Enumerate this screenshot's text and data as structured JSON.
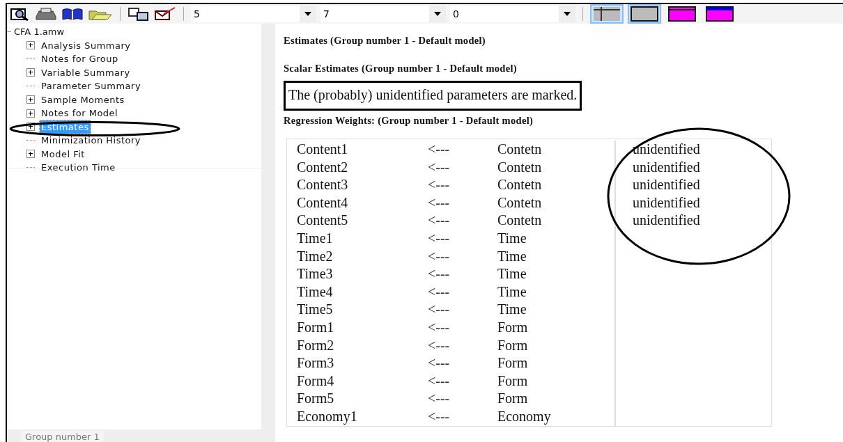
{
  "toolbar": {
    "icons": [
      {
        "kind": "preview"
      },
      {
        "kind": "print"
      },
      {
        "kind": "book"
      },
      {
        "kind": "folder"
      },
      {
        "kind": "copy"
      },
      {
        "kind": "check"
      }
    ],
    "combos": [
      {
        "value": "5"
      },
      {
        "value": "7"
      },
      {
        "value": "0"
      }
    ],
    "styles": [
      {
        "kind": "grid",
        "selected": true
      },
      {
        "kind": "plain",
        "selected": true
      },
      {
        "kind": "magenta",
        "selected": false
      },
      {
        "kind": "blue-magenta",
        "selected": false
      }
    ]
  },
  "tree": {
    "root": "CFA 1.amw",
    "items": [
      {
        "label": "Analysis Summary",
        "expandable": true,
        "selected": false
      },
      {
        "label": "Notes for Group",
        "expandable": false,
        "selected": false
      },
      {
        "label": "Variable Summary",
        "expandable": true,
        "selected": false
      },
      {
        "label": "Parameter Summary",
        "expandable": false,
        "selected": false
      },
      {
        "label": "Sample Moments",
        "expandable": true,
        "selected": false
      },
      {
        "label": "Notes for Model",
        "expandable": true,
        "selected": false
      },
      {
        "label": "Estimates",
        "expandable": true,
        "selected": true
      },
      {
        "label": "Minimization History",
        "expandable": false,
        "selected": false
      },
      {
        "label": "Model Fit",
        "expandable": true,
        "selected": false
      },
      {
        "label": "Execution Time",
        "expandable": false,
        "selected": false
      }
    ]
  },
  "group_tab": "Group number 1",
  "output": {
    "heading1": "Estimates (Group number 1 - Default model)",
    "heading2": "Scalar Estimates (Group number 1 - Default model)",
    "notice": "The (probably) unidentified parameters are marked.",
    "heading3": "Regression Weights: (Group number 1 - Default model)",
    "rows": [
      {
        "dependent": "Content1",
        "arrow": "<---",
        "factor": "Contetn",
        "estimate": "unidentified"
      },
      {
        "dependent": "Content2",
        "arrow": "<---",
        "factor": "Contetn",
        "estimate": "unidentified"
      },
      {
        "dependent": "Content3",
        "arrow": "<---",
        "factor": "Contetn",
        "estimate": "unidentified"
      },
      {
        "dependent": "Content4",
        "arrow": "<---",
        "factor": "Contetn",
        "estimate": "unidentified"
      },
      {
        "dependent": "Content5",
        "arrow": "<---",
        "factor": "Contetn",
        "estimate": "unidentified"
      },
      {
        "dependent": "Time1",
        "arrow": "<---",
        "factor": "Time"
      },
      {
        "dependent": "Time2",
        "arrow": "<---",
        "factor": "Time"
      },
      {
        "dependent": "Time3",
        "arrow": "<---",
        "factor": "Time"
      },
      {
        "dependent": "Time4",
        "arrow": "<---",
        "factor": "Time"
      },
      {
        "dependent": "Time5",
        "arrow": "<---",
        "factor": "Time"
      },
      {
        "dependent": "Form1",
        "arrow": "<---",
        "factor": "Form"
      },
      {
        "dependent": "Form2",
        "arrow": "<---",
        "factor": "Form"
      },
      {
        "dependent": "Form3",
        "arrow": "<---",
        "factor": "Form"
      },
      {
        "dependent": "Form4",
        "arrow": "<---",
        "factor": "Form"
      },
      {
        "dependent": "Form5",
        "arrow": "<---",
        "factor": "Form"
      },
      {
        "dependent": "Economy1",
        "arrow": "<---",
        "factor": "Economy"
      }
    ]
  }
}
